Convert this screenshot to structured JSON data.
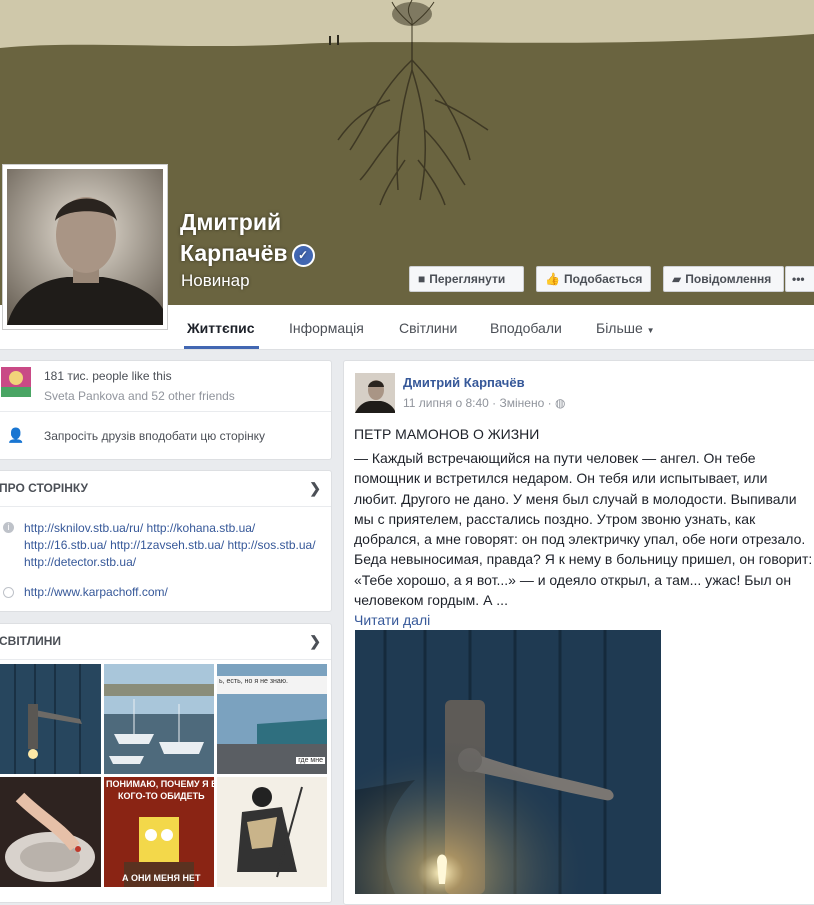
{
  "header": {
    "name_line1": "Дмитрий",
    "name_line2": "Карпачёв",
    "category": "Новинар",
    "verified_icon": "check-icon",
    "buttons": {
      "watch": "Переглянути",
      "like": "Подобається",
      "message": "Повідомлення",
      "more": "•••"
    }
  },
  "tabs": [
    "Життєпис",
    "Інформація",
    "Світлини",
    "Вподобали",
    "Більше"
  ],
  "likes_box": {
    "count": "181 тис. people like this",
    "friends": "Sveta Pankova and 52 other friends",
    "invite": "Запросіть друзів вподобати цю сторінку"
  },
  "about": {
    "title": "ПРО СТОРІНКУ",
    "links": [
      "http://sknilov.stb.ua/ru/",
      "http://kohana.stb.ua/",
      "http://16.stb.ua/",
      "http://1zavseh.stb.ua/",
      "http://sos.stb.ua/",
      "http://detector.stb.ua/"
    ],
    "website": "http://www.karpachoff.com/"
  },
  "photos": {
    "title": "СВІТЛИНИ",
    "captions": [
      "ь, есть, но я не знаю.",
      "где мне",
      "ПОНИМАЮ, ПОЧЕМУ Я БО",
      "КОГО-ТО ОБИДЕТЬ",
      "А ОНИ МЕНЯ НЕТ"
    ]
  },
  "post": {
    "author": "Дмитрий Карпачёв",
    "time": "11 липня о 8:40",
    "edited": "Змінено",
    "title": "ПЕТР МАМОНОВ О ЖИЗНИ",
    "lines": [
      "— Каждый встречающийся на пути человек — ангел. Он тебе",
      "помощник и встретился недаром. Он тебя или испытывает, или",
      "любит. Другого не дано. У меня был случай в молодости. Выпивали",
      "мы с приятелем, расстались поздно. Утром звоню узнать, как",
      "добрался, а мне говорят: он под электричку упал, обе ноги отрезало.",
      "Беда невыносимая, правда? Я к нему в больницу пришел, он говорит:",
      "«Тебе хорошо, а я вот...» — и одеяло открыл, а там... ужас! Был он",
      "человеком гордым. А ..."
    ],
    "read_more": "Читати далі"
  },
  "colors": {
    "cover_sky": "#cfc8aa",
    "cover_ground": "#6a6440",
    "accent": "#4267b2",
    "link": "#365899"
  }
}
